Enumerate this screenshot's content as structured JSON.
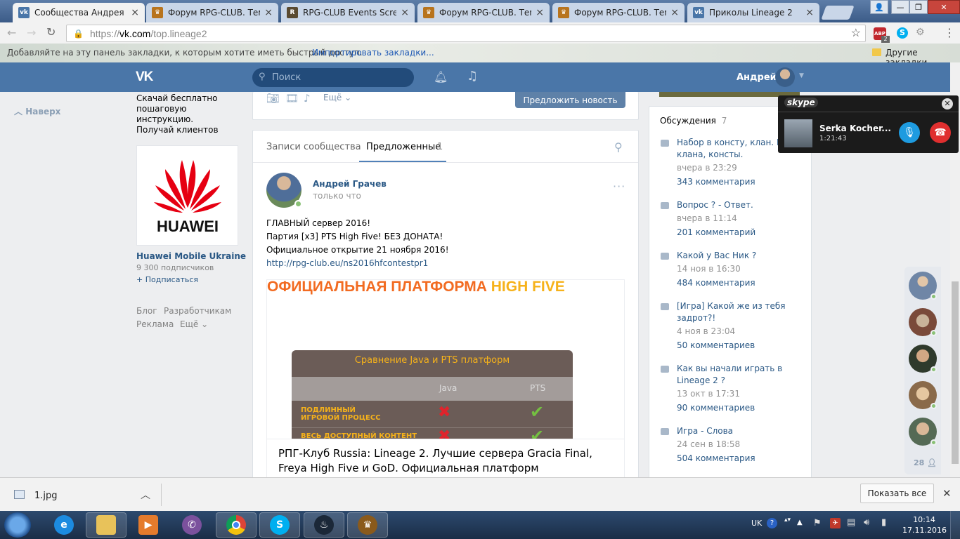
{
  "browser": {
    "tabs": [
      {
        "title": "Сообщества Андрея Гра",
        "icon": "vk-icon",
        "color": "#4a76a8"
      },
      {
        "title": "Форум RPG-CLUB. Тема",
        "icon": "rpg-club-icon",
        "color": "#b8741e"
      },
      {
        "title": "RPG-CLUB Events Screen",
        "icon": "rpg-events-icon",
        "color": "#5a4a30"
      },
      {
        "title": "Форум RPG-CLUB. Тема",
        "icon": "rpg-club-icon",
        "color": "#b8741e"
      },
      {
        "title": "Форум RPG-CLUB. Тема",
        "icon": "rpg-club-icon",
        "color": "#b8741e"
      },
      {
        "title": "Приколы Lineage 2",
        "icon": "vk-icon",
        "color": "#4a76a8"
      }
    ],
    "url_scheme": "https://",
    "url_host": "vk.com",
    "url_path": "/top.lineage2",
    "bookmarks_prompt": "Добавляйте на эту панель закладки, к которым хотите иметь быстрый доступ.",
    "import_bookmarks": "Импортировать закладки...",
    "other_bookmarks": "Другие закладки",
    "abp_badge": "2"
  },
  "vk": {
    "logo": "VK",
    "search_placeholder": "Поиск",
    "user_name": "Андрей",
    "back_to_top": "Наверх",
    "ad": {
      "text_lines": [
        "Скачай бесплатно",
        "пошаговую инструкцию.",
        "Получай клиентов"
      ]
    },
    "promo": {
      "brand": "HUAWEI",
      "name": "Huawei Mobile Ukraine",
      "subscribers": "9 300 подписчиков",
      "subscribe": "+ Подписаться"
    },
    "footer_links": {
      "blog": "Блог",
      "developers": "Разработчикам",
      "ads": "Реклама",
      "more": "Ещё"
    },
    "composer": {
      "more": "Ещё",
      "suggest_button": "Предложить новость"
    },
    "tabs": {
      "community_posts": "Записи сообщества",
      "suggested": "Предложенные",
      "suggested_count": "1"
    },
    "post": {
      "author": "Андрей Грачев",
      "time": "только что",
      "lines": [
        "ГЛАВНЫЙ сервер 2016!",
        "Партия [x3] PTS High Five! БЕЗ ДОНАТА!",
        "Официальное открытие 21 ноября 2016!"
      ],
      "link": "http://rpg-club.eu/ns2016hfcontestpr1",
      "banner_title_a": "ОФИЦИАЛЬНАЯ ПЛАТФОРМА",
      "banner_title_b": "HIGH FIVE",
      "table_title": "Сравнение Java и PTS платформ",
      "col_java": "Java",
      "col_pts": "PTS",
      "row1_a": "ПОДЛИННЫЙ",
      "row1_b": "ИГРОВОЙ ПРОЦЕСС",
      "row2": "ВЕСЬ ДОСТУПНЫЙ КОНТЕНТ",
      "snippet_title": "РПГ-Клуб Russia: Lineage 2. Лучшие сервера Gracia Final, Freya High Five и GoD. Официальная платформ"
    },
    "discussions": {
      "label": "Обсуждения",
      "count": "7",
      "items": [
        {
          "title": "Набор в консту, клан. По клана, консты.",
          "date": "вчера в 23:29",
          "comments": "343 комментария"
        },
        {
          "title": "Вопрос ? - Ответ.",
          "date": "вчера в 11:14",
          "comments": "201 комментарий"
        },
        {
          "title": "Какой у Вас Ник ?",
          "date": "14 ноя в 16:30",
          "comments": "484 комментария"
        },
        {
          "title": "[Игра] Какой же из тебя задрот?!",
          "date": "4 ноя в 23:04",
          "comments": "50 комментариев"
        },
        {
          "title": "Как вы начали играть в Lineage 2 ?",
          "date": "13 окт в 17:31",
          "comments": "90 комментариев"
        },
        {
          "title": "Игра - Слова",
          "date": "24 сен в 18:58",
          "comments": "504 комментария"
        }
      ]
    },
    "friends_online_count": "28"
  },
  "skype": {
    "brand": "skype",
    "caller": "Serka Kocher...",
    "duration": "1:21:43"
  },
  "downloads": {
    "file": "1.jpg",
    "show_all": "Показать все"
  },
  "taskbar": {
    "lang": "UK",
    "time": "10:14",
    "date": "17.11.2016"
  },
  "colors": {
    "vk_blue": "#4a76a8",
    "link": "#2a5885",
    "suggest_btn": "#5e81a8",
    "banner_orange": "#f26b21",
    "banner_yellow": "#f6b21a"
  }
}
